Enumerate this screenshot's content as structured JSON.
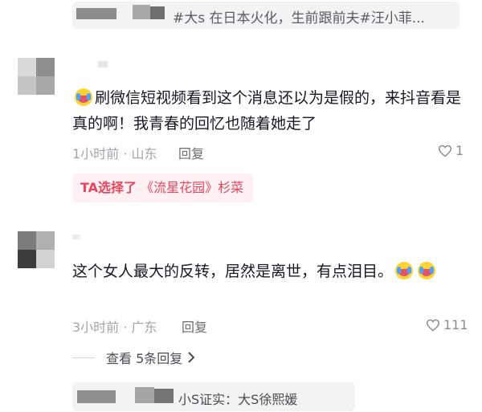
{
  "top_quote": {
    "text": "#大s 在日本火化，生前跟前夫#汪小菲..."
  },
  "comments": [
    {
      "text": "刷微信短视频看到这个消息还以为是假的，来抖音看是真的啊！我青春的回忆也随着她走了",
      "meta": "1小时前 · 山东",
      "reply_label": "回复",
      "likes": "1"
    },
    {
      "text": "这个女人最大的反转，居然是离世，有点泪目。",
      "meta": "3小时前 · 广东",
      "reply_label": "回复",
      "likes": "111"
    }
  ],
  "choice_tag": {
    "prefix": "TA选择了",
    "option": "《流星花园》杉菜"
  },
  "expand_replies": {
    "label": "查看 5条回复"
  },
  "bottom_quote": {
    "text": "小S证实：大S徐熙媛"
  },
  "icons": {
    "cry_emoji": "loudly-crying-emoji",
    "like": "heart-outline-icon",
    "expand": "chevron-right-icon"
  },
  "colors": {
    "accent": "#e8455d",
    "meta_gray": "#a3a5ab",
    "pill_bg": "#f3f3f5"
  }
}
